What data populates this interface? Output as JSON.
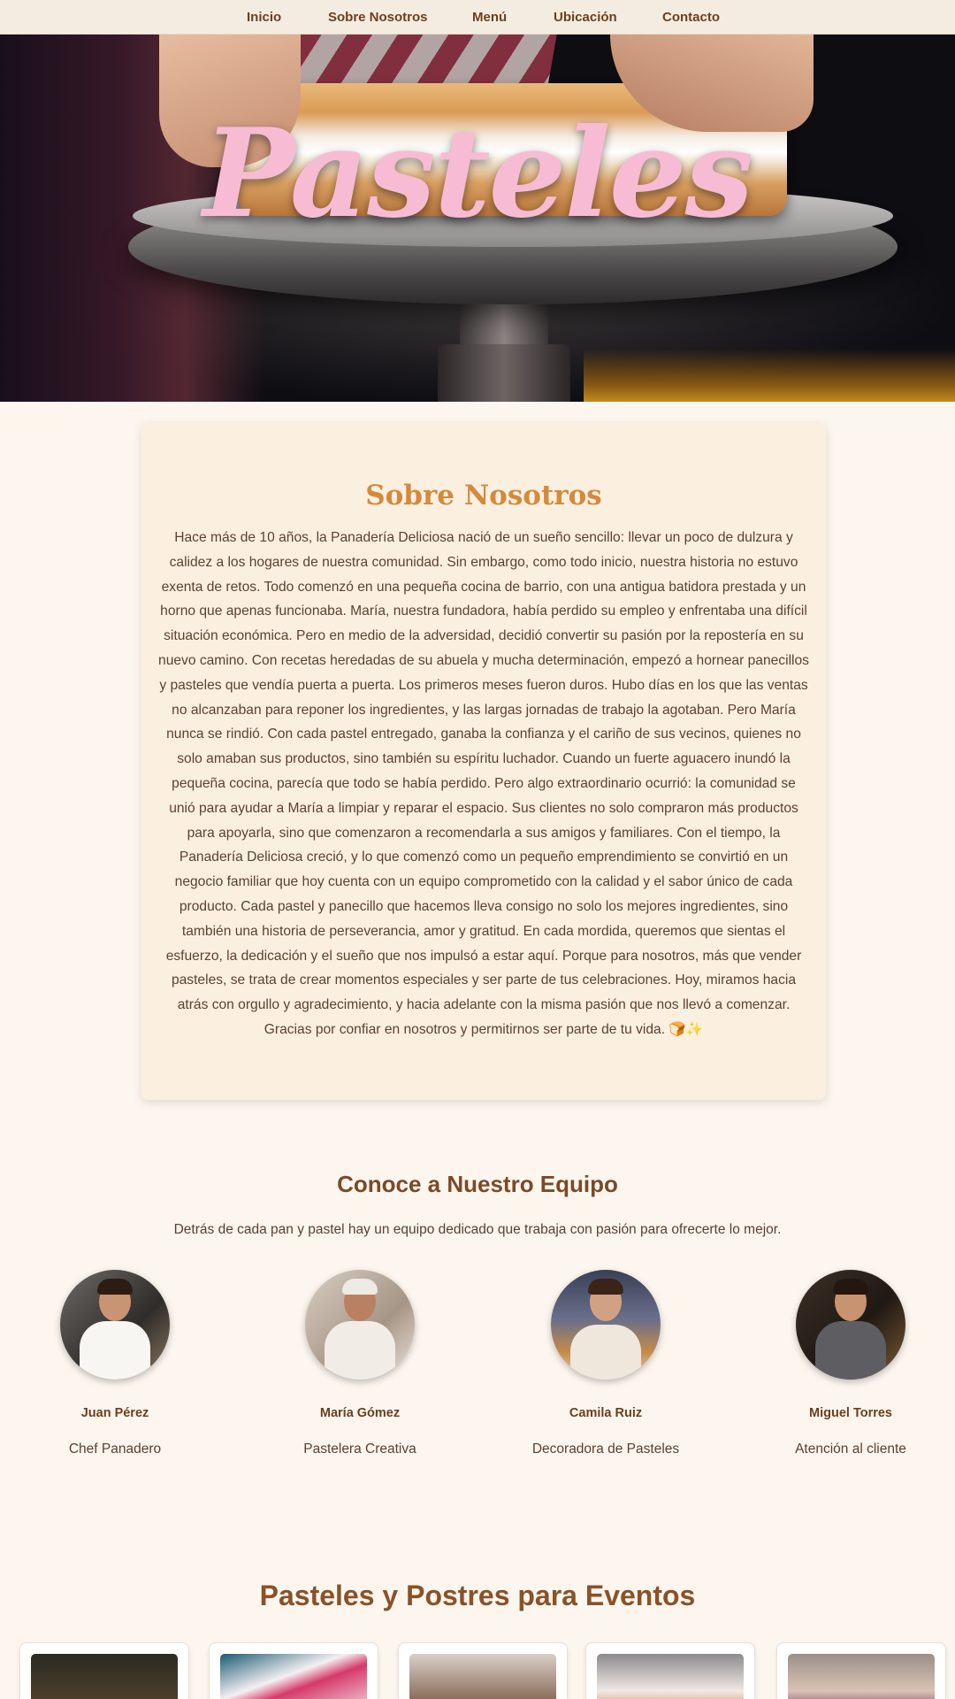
{
  "nav": {
    "items": [
      "Inicio",
      "Sobre Nosotros",
      "Menú",
      "Ubicación",
      "Contacto"
    ]
  },
  "hero": {
    "title": "Pasteles"
  },
  "about": {
    "title": "Sobre Nosotros",
    "text": "Hace más de 10 años, la Panadería Deliciosa nació de un sueño sencillo: llevar un poco de dulzura y calidez a los hogares de nuestra comunidad. Sin embargo, como todo inicio, nuestra historia no estuvo exenta de retos. Todo comenzó en una pequeña cocina de barrio, con una antigua batidora prestada y un horno que apenas funcionaba. María, nuestra fundadora, había perdido su empleo y enfrentaba una difícil situación económica. Pero en medio de la adversidad, decidió convertir su pasión por la repostería en su nuevo camino. Con recetas heredadas de su abuela y mucha determinación, empezó a hornear panecillos y pasteles que vendía puerta a puerta. Los primeros meses fueron duros. Hubo días en los que las ventas no alcanzaban para reponer los ingredientes, y las largas jornadas de trabajo la agotaban. Pero María nunca se rindió. Con cada pastel entregado, ganaba la confianza y el cariño de sus vecinos, quienes no solo amaban sus productos, sino también su espíritu luchador. Cuando un fuerte aguacero inundó la pequeña cocina, parecía que todo se había perdido. Pero algo extraordinario ocurrió: la comunidad se unió para ayudar a María a limpiar y reparar el espacio. Sus clientes no solo compraron más productos para apoyarla, sino que comenzaron a recomendarla a sus amigos y familiares. Con el tiempo, la Panadería Deliciosa creció, y lo que comenzó como un pequeño emprendimiento se convirtió en un negocio familiar que hoy cuenta con un equipo comprometido con la calidad y el sabor único de cada producto. Cada pastel y panecillo que hacemos lleva consigo no solo los mejores ingredientes, sino también una historia de perseverancia, amor y gratitud. En cada mordida, queremos que sientas el esfuerzo, la dedicación y el sueño que nos impulsó a estar aquí. Porque para nosotros, más que vender pasteles, se trata de crear momentos especiales y ser parte de tus celebraciones. Hoy, miramos hacia atrás con orgullo y agradecimiento, y hacia adelante con la misma pasión que nos llevó a comenzar. Gracias por confiar en nosotros y permitirnos ser parte de tu vida. 🍞✨"
  },
  "team": {
    "title": "Conoce a Nuestro Equipo",
    "subtitle": "Detrás de cada pan y pastel hay un equipo dedicado que trabaja con pasión para ofrecerte lo mejor.",
    "members": [
      {
        "name": "Juan Pérez",
        "role": "Chef Panadero"
      },
      {
        "name": "María Gómez",
        "role": "Pastelera Creativa"
      },
      {
        "name": "Camila Ruiz",
        "role": "Decoradora de Pasteles"
      },
      {
        "name": "Miguel Torres",
        "role": "Atención al cliente"
      }
    ]
  },
  "events": {
    "title": "Pasteles y Postres para Eventos"
  },
  "colors": {
    "accent": "#d48a3c",
    "brown": "#6b3f1f",
    "hero_title": "#f7bcd4",
    "page_bg": "#fcf6ef"
  }
}
